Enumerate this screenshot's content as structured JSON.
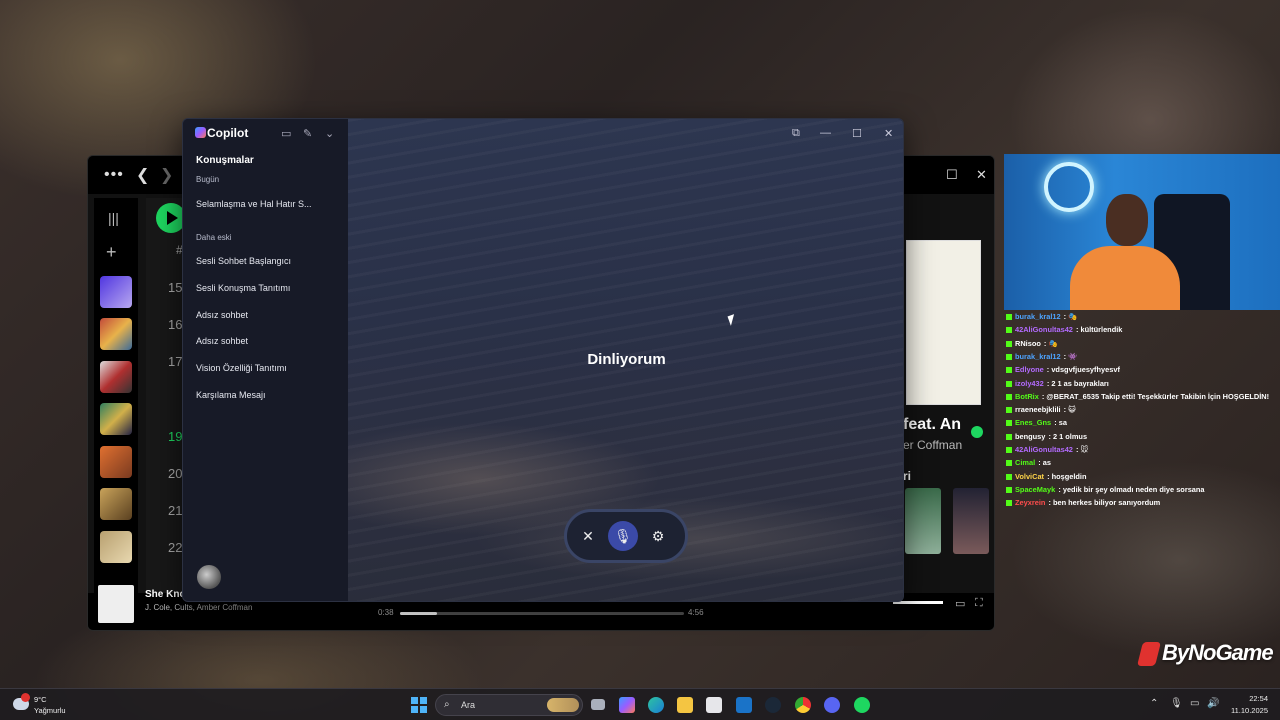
{
  "copilot": {
    "app_name": "Copilot",
    "section_title": "Konuşmalar",
    "group_today": "Bugün",
    "group_older": "Daha eski",
    "today_items": [
      "Selamlaşma ve Hal Hatır S..."
    ],
    "older_items": [
      "Sesli Sohbet Başlangıcı",
      "Sesli Konuşma Tanıtımı",
      "Adsız sohbet",
      "Adsız sohbet",
      "Vision Özelliği Tanıtımı",
      "Karşılama Mesajı"
    ],
    "status": "Dinliyorum",
    "icons": {
      "close": "✕",
      "mic": "🎙",
      "settings": "⚙",
      "sidebar": "▭",
      "new_chat": "✎",
      "dropdown": "⌄",
      "popout": "⧉",
      "minimize": "—",
      "maximize": "☐",
      "window_close": "✕"
    }
  },
  "spotify": {
    "track_numbers": [
      "15",
      "16",
      "17",
      "",
      "19",
      "20",
      "21",
      "22"
    ],
    "active_track": "19",
    "column_hash": "#",
    "now_playing_title": "She Knows",
    "now_playing_artists": "J. Cole, Cults, Amber Coffman",
    "right_title": "feat. An",
    "right_artist": "er Coffman",
    "right_label": "ri",
    "elapsed": "0:38",
    "duration": "4:56",
    "progress_fraction": 0.13
  },
  "chat": [
    {
      "user": "burak_kral12",
      "color": "#4da3ff",
      "msg": ": 🎭"
    },
    {
      "user": "42AliGonultas42",
      "color": "#b36bff",
      "msg": ": kültürlendik"
    },
    {
      "user": "RNisoo",
      "color": "#ffffff",
      "msg": ": 🎭"
    },
    {
      "user": "burak_kral12",
      "color": "#4da3ff",
      "msg": ": 👾"
    },
    {
      "user": "Edlyone",
      "color": "#b36bff",
      "msg": ": vdsgvfjuesyfhyesvf"
    },
    {
      "user": "izoly432",
      "color": "#b36bff",
      "msg": ": 2 1 as bayrakları"
    },
    {
      "user": "BotRix",
      "color": "#53fc18",
      "msg": ": @BERAT_6535 Takip etti! Teşekkürler Takibin İçin HOŞGELDİN!"
    },
    {
      "user": "rraeneebjklili",
      "color": "#ffffff",
      "msg": ": 😺"
    },
    {
      "user": "Enes_Gns",
      "color": "#53fc18",
      "msg": ": sa"
    },
    {
      "user": "bengusy",
      "color": "#ffffff",
      "msg": ": 2 1 olmus"
    },
    {
      "user": "42AliGonultas42",
      "color": "#b36bff",
      "msg": ": 🐭"
    },
    {
      "user": "Cimal",
      "color": "#53fc18",
      "msg": ": as"
    },
    {
      "user": "VolviCat",
      "color": "#ffd54a",
      "msg": ": hoşgeldin"
    },
    {
      "user": "SpaceMayk",
      "color": "#53fc18",
      "msg": ": yedik bir şey olmadı neden diye sorsana"
    },
    {
      "user": "Zeyxrein",
      "color": "#ff4d4d",
      "msg": ": ben herkes biliyor sanıyordum"
    }
  ],
  "watermark": "ByNoGame",
  "taskbar": {
    "temperature": "9°C",
    "condition": "Yağmurlu",
    "search_placeholder": "Ara",
    "time": "22:54",
    "date": "11.10.2025"
  }
}
